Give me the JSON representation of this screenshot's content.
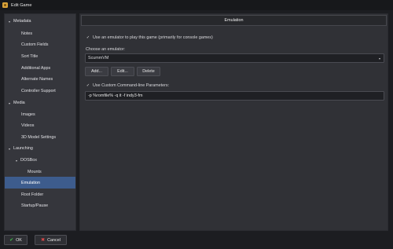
{
  "window": {
    "title": "Edit Game"
  },
  "sidebar": {
    "items": [
      {
        "label": "Metadata",
        "arrow": "▾"
      },
      {
        "label": "Notes"
      },
      {
        "label": "Custom Fields"
      },
      {
        "label": "Sort Title"
      },
      {
        "label": "Additional Apps"
      },
      {
        "label": "Alternate Names"
      },
      {
        "label": "Controller Support"
      },
      {
        "label": "Media",
        "arrow": "▾"
      },
      {
        "label": "Images"
      },
      {
        "label": "Videos"
      },
      {
        "label": "3D Model Settings"
      },
      {
        "label": "Launching",
        "arrow": "▾"
      },
      {
        "label": "DOSBox",
        "arrow": "▾"
      },
      {
        "label": "Mounts"
      },
      {
        "label": "Emulation"
      },
      {
        "label": "Root Folder"
      },
      {
        "label": "Startup/Pause"
      }
    ],
    "selected": "Emulation"
  },
  "main": {
    "section_title": "Emulation",
    "use_emulator": {
      "checked": true,
      "mark": "✓",
      "label": "Use an emulator to play this game (primarily for console games)"
    },
    "choose_label": "Choose an emulator:",
    "emulator_select": {
      "value": "ScummVM",
      "chevron": "▾"
    },
    "buttons": {
      "add": "Add...",
      "edit": "Edit...",
      "delete": "Delete"
    },
    "use_custom_params": {
      "checked": true,
      "mark": "✓",
      "label": "Use Custom Command-line Parameters:"
    },
    "params_value": "-p %romfile% -q it -f indy3-fm"
  },
  "footer": {
    "ok": {
      "label": "OK",
      "icon": "✔"
    },
    "cancel": {
      "label": "Cancel",
      "icon": "✖"
    }
  }
}
